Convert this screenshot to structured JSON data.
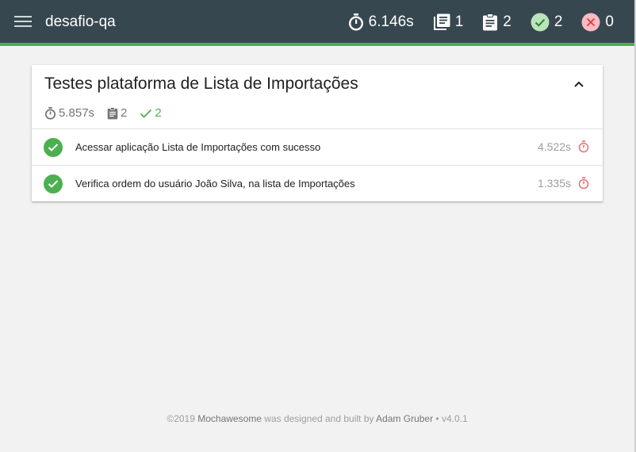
{
  "topbar": {
    "title": "desafio-qa",
    "duration": "6.146s",
    "suites": "1",
    "tests": "2",
    "passes": "2",
    "failures": "0"
  },
  "suite": {
    "title": "Testes plataforma de Lista de Importações",
    "duration": "5.857s",
    "tests": "2",
    "passes": "2",
    "items": [
      {
        "title": "Acessar aplicação Lista de Importações com sucesso",
        "duration": "4.522s"
      },
      {
        "title": "Verifica ordem do usuário João Silva, na lista de Importações",
        "duration": "1.335s"
      }
    ]
  },
  "footer": {
    "copyright": "©2019 ",
    "brand": "Mochawesome",
    "text": " was designed and built by ",
    "author": "Adam Gruber",
    "version": " • v4.0.1"
  },
  "colors": {
    "topbar": "#37474f",
    "accent": "#4caf50",
    "fail": "#f44336"
  }
}
